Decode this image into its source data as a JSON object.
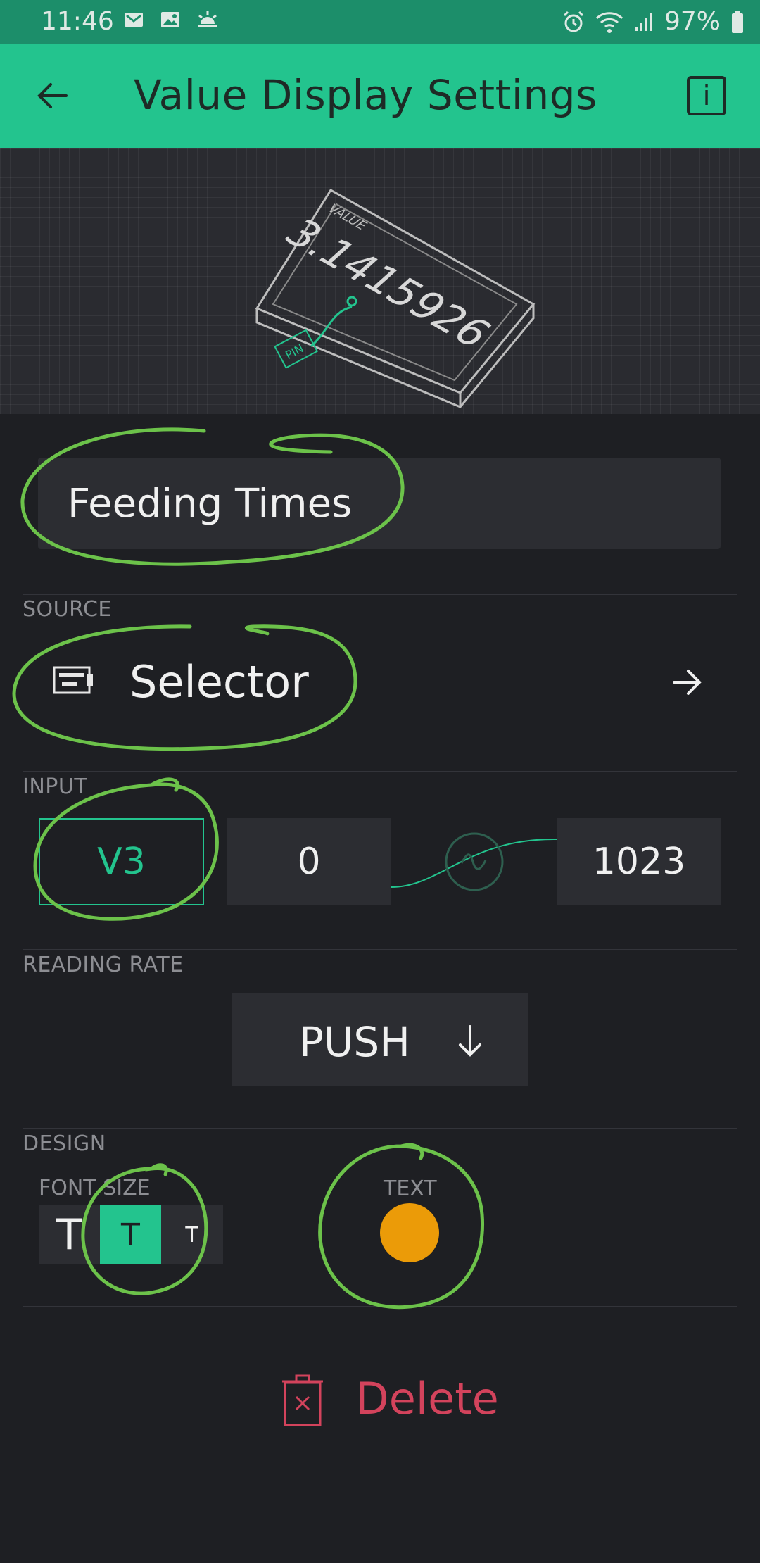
{
  "status_bar": {
    "time": "11:46",
    "battery_percent": "97%",
    "left_icons": [
      "gmail-icon",
      "image-icon",
      "weather-icon"
    ],
    "right_icons": [
      "alarm-icon",
      "wifi-icon",
      "signal-icon",
      "battery-icon"
    ]
  },
  "app_bar": {
    "title": "Value Display Settings",
    "info_label": "i"
  },
  "preview": {
    "value_label": "VALUE",
    "value_text": "3.1415926",
    "pin_label": "PIN"
  },
  "widget": {
    "name": "Feeding Times"
  },
  "source": {
    "section_label": "SOURCE",
    "value": "Selector"
  },
  "input": {
    "section_label": "INPUT",
    "pin": "V3",
    "min": "0",
    "max": "1023"
  },
  "reading_rate": {
    "section_label": "READING RATE",
    "value": "PUSH"
  },
  "design": {
    "section_label": "DESIGN",
    "font_size_label": "FONT SIZE",
    "font_options": [
      "T",
      "T",
      "T"
    ],
    "selected_font_index": 1,
    "text_color_label": "TEXT",
    "text_color": "#eb9b08"
  },
  "delete": {
    "label": "Delete"
  },
  "colors": {
    "accent": "#23c48e",
    "status_bar": "#1c8e6a",
    "background": "#1e1f23",
    "danger": "#d3435c",
    "annotation": "#6cc24a"
  }
}
